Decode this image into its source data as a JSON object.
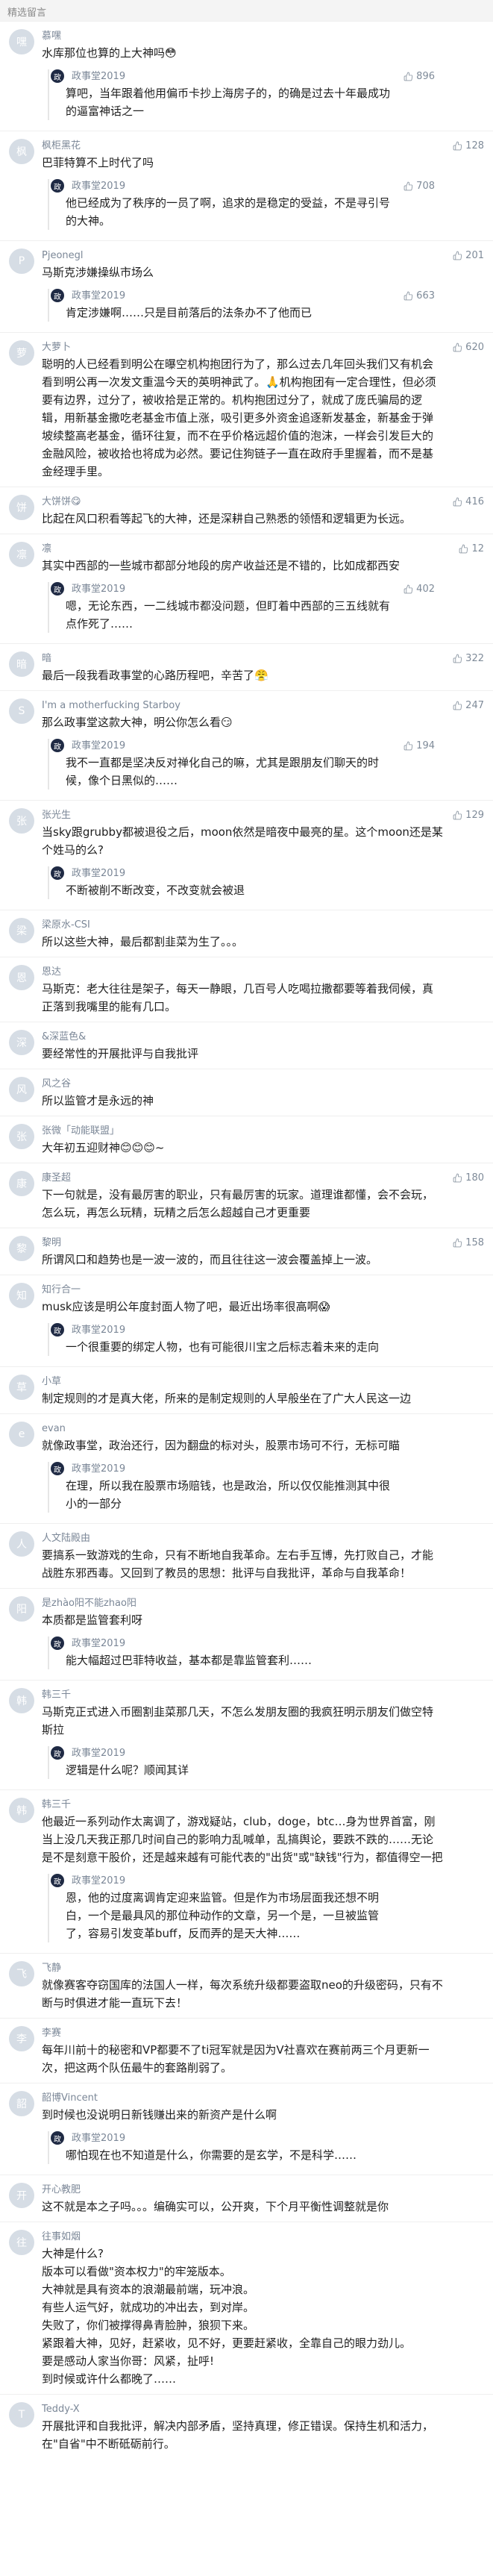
{
  "header": {
    "title": "精选留言"
  },
  "comments": [
    {
      "user": "慕嘿",
      "avatar": "嘿",
      "text": "水库那位也算的上大神吗😳",
      "likes": "",
      "reply": {
        "user": "政事堂2019",
        "text": "算吧，当年跟着他用偏币卡抄上海房子的，的确是过去十年最成功的逼富神话之一",
        "likes": "896"
      }
    },
    {
      "user": "枫柜黑花",
      "avatar": "枫",
      "text": "巴菲特算不上时代了吗",
      "likes": "128",
      "reply": {
        "user": "政事堂2019",
        "text": "他已经成为了秩序的一员了啊，追求的是稳定的受益，不是寻引号的大神。",
        "likes": "708"
      }
    },
    {
      "user": "Pjeonegl",
      "avatar": "P",
      "text": "马斯克涉嫌操纵市场么",
      "likes": "201",
      "reply": {
        "user": "政事堂2019",
        "text": "肯定涉嫌啊……只是目前落后的法条办不了他而已",
        "likes": "663"
      }
    },
    {
      "user": "大萝卜",
      "avatar": "萝",
      "text": "聪明的人已经看到明公在曝空机构抱团行为了，那么过去几年回头我们又有机会看到明公再一次发文重温今天的英明神武了。🙏机构抱团有一定合理性，但必须要有边界，过分了，被收拾是正常的。机构抱团过分了，就成了庞氏骗局的逻辑，用新基金撒吃老基金市值上涨，吸引更多外资金追逐新发基金，新基金于弹坡续整高老基金，循环往复，而不在乎价格远超价值的泡沫，一样会引发巨大的金融风险，被收拾也将成为必然。要记住狗链子一直在政府手里握着，而不是基金经理手里。",
      "likes": "620",
      "reply": null
    },
    {
      "user": "大饼饼😋",
      "avatar": "饼",
      "text": "比起在风口积看等起飞的大神，还是深耕自己熟悉的领悟和逻辑更为长远。",
      "likes": "416",
      "reply": null
    },
    {
      "user": "凛",
      "avatar": "凛",
      "text": "其实中西部的一些城市都部分地段的房产收益还是不错的，比如成都西安",
      "likes": "12",
      "reply": {
        "user": "政事堂2019",
        "text": "嗯，无论东西，一二线城市都没问题，但盯着中西部的三五线就有点作死了……",
        "likes": "402"
      }
    },
    {
      "user": "暗",
      "avatar": "暗",
      "text": "最后一段我看政事堂的心路历程吧，辛苦了😤",
      "likes": "322",
      "reply": null
    },
    {
      "user": "I'm a motherfucking Starboy",
      "avatar": "S",
      "text": "那么政事堂这款大神，明公你怎么看😏",
      "likes": "247",
      "reply": {
        "user": "政事堂2019",
        "text": "我不一直都是坚决反对禅化自己的嘛，尤其是跟朋友们聊天的时候，像个日黑似的……",
        "likes": "194"
      }
    },
    {
      "user": "张光生",
      "avatar": "张",
      "text": "当sky跟grubby都被退役之后，moon依然是暗夜中最亮的星。这个moon还是某个姓马的么?",
      "likes": "129",
      "reply": {
        "user": "政事堂2019",
        "text": "不断被削不断改变，不改变就会被退",
        "likes": ""
      }
    },
    {
      "user": "梁原水-CSI",
      "avatar": "梁",
      "text": "所以这些大神，最后都割韭菜为生了。。。",
      "likes": "",
      "reply": null
    },
    {
      "user": "恩达",
      "avatar": "恩",
      "text": "马斯克：老大往往是架子，每天一静眼，几百号人吃喝拉撒都要等着我伺候，真正落到我嘴里的能有几口。",
      "likes": "",
      "reply": null
    },
    {
      "user": "&深蓝色&",
      "avatar": "深",
      "text": "要经常性的开展批评与自我批评",
      "likes": "",
      "reply": null
    },
    {
      "user": "风之谷",
      "avatar": "风",
      "text": "所以监管才是永远的神",
      "likes": "",
      "reply": null
    },
    {
      "user": "张微「动能联盟」",
      "avatar": "张",
      "text": "大年初五迎财神😊😊😊~",
      "likes": "",
      "reply": null
    },
    {
      "user": "康圣超",
      "avatar": "康",
      "text": "下一句就是，没有最厉害的职业，只有最厉害的玩家。道理谁都懂，会不会玩，怎么玩，再怎么玩精，玩精之后怎么超越自己才更重要",
      "likes": "180",
      "reply": null
    },
    {
      "user": "黎明",
      "avatar": "黎",
      "text": "所谓风口和趋势也是一波一波的，而且往往这一波会覆盖掉上一波。",
      "likes": "158",
      "reply": null
    },
    {
      "user": "知行合一",
      "avatar": "知",
      "text": "musk应该是明公年度封面人物了吧，最近出场率很高啊😱",
      "likes": "",
      "reply": {
        "user": "政事堂2019",
        "text": "一个很重要的绑定人物，也有可能很川宝之后标志着未来的走向",
        "likes": ""
      }
    },
    {
      "user": "小草",
      "avatar": "草",
      "text": "制定规则的才是真大佬，所来的是制定规则的人早般坐在了广大人民这一边",
      "likes": "",
      "reply": null
    },
    {
      "user": "evan",
      "avatar": "e",
      "text": "就像政事堂，政治还行，因为翻盘的标对头，股票市场可不行，无标可瞄",
      "likes": "",
      "reply": {
        "user": "政事堂2019",
        "text": "在理，所以我在股票市场赔钱，也是政治，所以仅仅能推测其中很小的一部分",
        "likes": ""
      }
    },
    {
      "user": "人文陆殿由",
      "avatar": "人",
      "text": "要搞系一致游戏的生命，只有不断地自我革命。左右手互博，先打败自己，才能战胜东邪西毒。又回到了教员的思想：批评与自我批评，革命与自我革命！",
      "likes": "",
      "reply": null
    },
    {
      "user": "是zhào阳不能zhao阳",
      "avatar": "阳",
      "text": "本质都是监管套利呀",
      "likes": "",
      "reply": {
        "user": "政事堂2019",
        "text": "能大幅超过巴菲特收益，基本都是靠监管套利……",
        "likes": ""
      }
    },
    {
      "user": "韩三千",
      "avatar": "韩",
      "text": "马斯克正式进入币圈割韭菜那几天，不怎么发朋友圈的我疯狂明示朋友们做空特斯拉",
      "likes": "",
      "reply": {
        "user": "政事堂2019",
        "text": "逻辑是什么呢？顺闻其详",
        "likes": ""
      }
    },
    {
      "user": "韩三千",
      "avatar": "韩",
      "text": "他最近一系列动作太离调了，游戏疑站，club，doge，btc…身为世界首富，刚当上没几天我正那几时间自己的影响力乱喊单，乱搞舆论，要跌不跌的……无论是不是刻意干股价，还是越来越有可能代表的\"出货\"或\"缺钱\"行为，都值得空一把",
      "likes": "",
      "reply": {
        "user": "政事堂2019",
        "text": "恩，他的过度离调肯定迎来监管。但是作为市场层面我还想不明白，一个是最具风的那位种动作的文章，另一个是，一旦被监管了，容易引发变革buff，反而弄的是天大神……",
        "likes": ""
      }
    },
    {
      "user": "飞静",
      "avatar": "飞",
      "text": "就像赛客夺窃国库的法国人一样，每次系统升级都要盗取neo的升级密码，只有不断与时俱进才能一直玩下去！",
      "likes": "",
      "reply": null
    },
    {
      "user": "李赛",
      "avatar": "李",
      "text": "每年川前十的秘密和VP都要不了ti冠军就是因为V社喜欢在赛前两三个月更新一次，把这两个队伍最牛的套路削弱了。",
      "likes": "",
      "reply": null
    },
    {
      "user": "韶博Vincent",
      "avatar": "韶",
      "text": "到时候也没说明日新钱赚出来的新资产是什么啊",
      "likes": "",
      "reply": {
        "user": "政事堂2019",
        "text": "哪怕现在也不知道是什么，你需要的是玄学，不是科学……",
        "likes": ""
      }
    },
    {
      "user": "开心教肥",
      "avatar": "开",
      "text": "这不就是本之子吗。。。编确实可以，公开爽，下个月平衡性调整就是你",
      "likes": "",
      "reply": null
    },
    {
      "user": "往事如烟",
      "avatar": "往",
      "text": "大神是什么?\n版本可以看做\"资本权力\"的牢笼版本。\n大神就是具有资本的浪潮最前端，玩冲浪。\n有些人运气好，就成功的冲出去，到对岸。\n失败了，你们被撑得鼻青脸肿，狼狈下来。\n紧跟着大神，见好，赶紧收，见不好，更要赶紧收，全靠自己的眼力劲儿。\n要是感动人家当你哥：风紧，扯呼!\n到时候或许什么都晚了……",
      "likes": "",
      "reply": null
    },
    {
      "user": "Teddy-X",
      "avatar": "T",
      "text": "开展批评和自我批评，解决内部矛盾，坚持真理，修正错误。保持生机和活力，在\"自省\"中不断砥砺前行。",
      "likes": "",
      "reply": null
    }
  ]
}
